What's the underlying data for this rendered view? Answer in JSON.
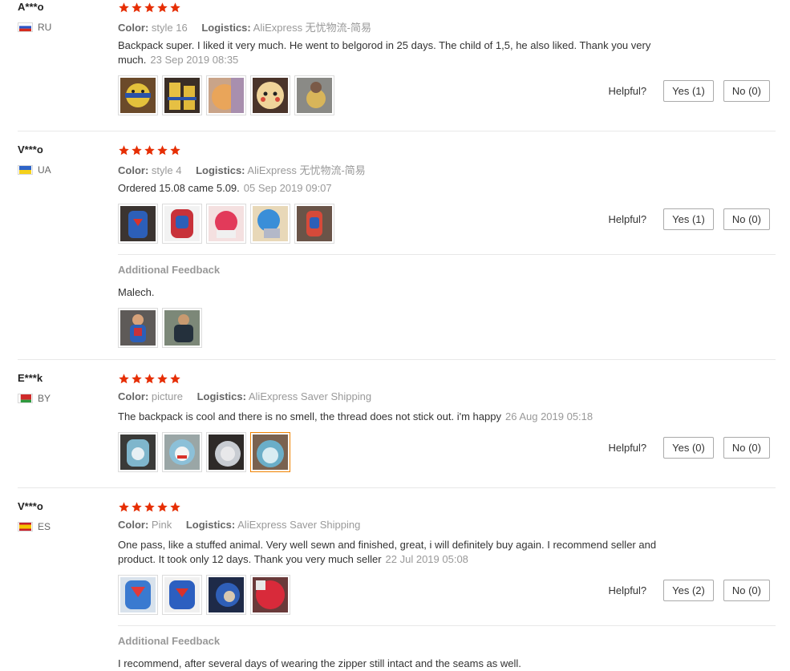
{
  "labels": {
    "color": "Color:",
    "logistics": "Logistics:",
    "helpful": "Helpful?",
    "additional_feedback": "Additional Feedback"
  },
  "colors": {
    "star": "#e62e04",
    "accent_border": "#f08200"
  },
  "reviews": [
    {
      "user": "A***o",
      "country": "RU",
      "flag": "flag-russia-icon",
      "rating": 5,
      "color": "style 16",
      "logistics": "AliExpress 无忧物流-简易",
      "text": "Backpack super. I liked it very much. He went to belgorod in 25 days. The child of 1,5, he also liked. Thank you very much.",
      "date": "23 Sep 2019 08:35",
      "yes": "Yes (1)",
      "no": "No (0)"
    },
    {
      "user": "V***o",
      "country": "UA",
      "flag": "flag-ukraine-icon",
      "rating": 5,
      "color": "style 4",
      "logistics": "AliExpress 无忧物流-简易",
      "text": "Ordered 15.08 came 5.09.",
      "date": "05 Sep 2019 09:07",
      "yes": "Yes (1)",
      "no": "No (0)",
      "additional": {
        "text": "Malech."
      }
    },
    {
      "user": "E***k",
      "country": "BY",
      "flag": "flag-belarus-icon",
      "rating": 5,
      "color": "picture",
      "logistics": "AliExpress Saver Shipping",
      "text": "The backpack is cool and there is no smell, the thread does not stick out. i'm happy",
      "date": "26 Aug 2019 05:18",
      "yes": "Yes (0)",
      "no": "No (0)"
    },
    {
      "user": "V***o",
      "country": "ES",
      "flag": "flag-spain-icon",
      "rating": 5,
      "color": "Pink",
      "logistics": "AliExpress Saver Shipping",
      "text": "One pass, like a stuffed animal. Very well sewn and finished, great, i will definitely buy again. I recommend seller and product. It took only 12 days. Thank you very much seller",
      "date": "22 Jul 2019 05:08",
      "yes": "Yes (2)",
      "no": "No (0)",
      "additional": {
        "text": "I recommend, after several days of wearing the zipper still intact and the seams as well."
      }
    }
  ]
}
